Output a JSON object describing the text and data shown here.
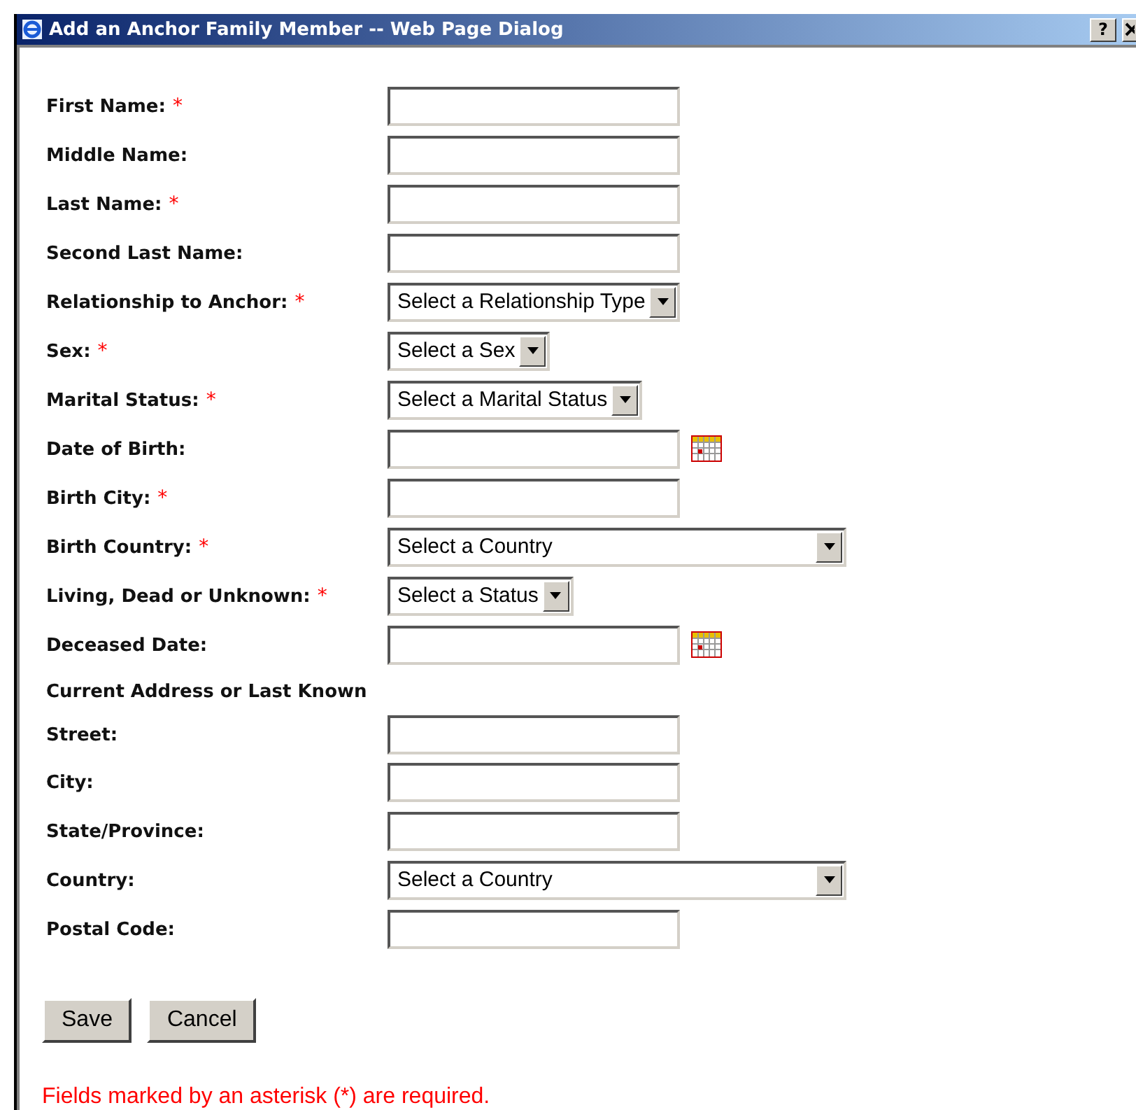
{
  "window": {
    "title": "Add an Anchor Family Member -- Web Page Dialog",
    "help": "?"
  },
  "fields": [
    {
      "label": "First Name:",
      "mark": "*",
      "kind": "text"
    },
    {
      "label": "Middle Name:",
      "kind": "text"
    },
    {
      "label": "Last Name:",
      "mark": "*",
      "kind": "text"
    },
    {
      "label": "Second Last Name:",
      "kind": "text"
    },
    {
      "label": "Relationship to Anchor:",
      "mark": "*",
      "kind": "select",
      "value": "Select a Relationship Type"
    },
    {
      "label": "Sex:",
      "mark": "*",
      "kind": "select",
      "value": "Select a Sex"
    },
    {
      "label": "Marital Status:",
      "mark": "*",
      "kind": "select",
      "value": "Select a Marital Status"
    },
    {
      "label": "Date of Birth:",
      "kind": "date"
    },
    {
      "label": "Birth City:",
      "mark": "*",
      "kind": "text"
    },
    {
      "label": "Birth Country:",
      "mark": "*",
      "kind": "wide-select",
      "value": "Select a Country"
    },
    {
      "label": "Living, Dead or Unknown:",
      "mark": "*",
      "kind": "select",
      "value": "Select a Status"
    },
    {
      "label": "Deceased Date:",
      "kind": "date"
    },
    {
      "label": "Current Address or Last Known",
      "kind": "heading"
    },
    {
      "label": "Street:",
      "kind": "text"
    },
    {
      "label": "City:",
      "kind": "text"
    },
    {
      "label": "State/Province:",
      "kind": "text"
    },
    {
      "label": "Country:",
      "kind": "wide-select",
      "value": "Select a Country"
    },
    {
      "label": "Postal Code:",
      "kind": "text"
    }
  ],
  "buttons": [
    "Save",
    "Cancel"
  ],
  "note": "Fields marked by an asterisk (*) are required."
}
